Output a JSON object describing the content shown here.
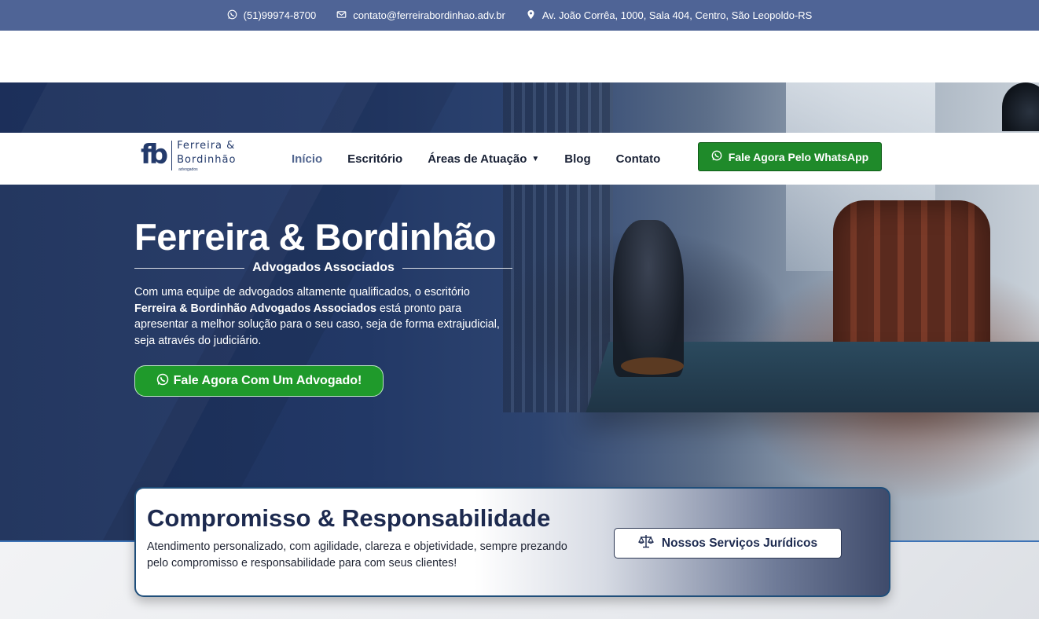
{
  "topbar": {
    "phone": "(51)99974-8700",
    "email": "contato@ferreirabordinhao.adv.br",
    "address": "Av. João Corrêa, 1000, Sala 404, Centro, São Leopoldo-RS",
    "icons": [
      "whatsapp-icon",
      "envelope-icon",
      "map-pin-icon"
    ]
  },
  "logo": {
    "mark": "fb",
    "line1": "Ferreira &",
    "line2": "Bordinhão",
    "line3": "advogados"
  },
  "nav": {
    "items": [
      {
        "label": "Início",
        "active": true
      },
      {
        "label": "Escritório",
        "active": false
      },
      {
        "label": "Áreas de Atuação",
        "active": false,
        "dropdown": true
      },
      {
        "label": "Blog",
        "active": false
      },
      {
        "label": "Contato",
        "active": false
      }
    ],
    "cta": "Fale Agora Pelo WhatsApp"
  },
  "hero": {
    "title": "Ferreira & Bordinhão",
    "subtitle": "Advogados Associados",
    "text_before": "Com uma equipe de advogados altamente qualificados, o escritório ",
    "text_bold": "Ferreira & Bordinhão Advogados Associados",
    "text_after": " está pronto para apresentar a melhor solução para o seu caso, seja de forma extrajudicial, seja através do judiciário.",
    "button": "Fale Agora Com Um Advogado!"
  },
  "card": {
    "title": "Compromisso & Responsabilidade",
    "text": "Atendimento personalizado, com agilidade, clareza e objetividade, sempre prezando pelo compromisso e responsabilidade para com seus clientes!",
    "button": "Nossos Serviços Jurídicos"
  },
  "colors": {
    "topbar_bg": "#4f6496",
    "primary_navy": "#1d2a4f",
    "whatsapp_green": "#1f8a2a",
    "accent_blue": "#3d73b6"
  }
}
